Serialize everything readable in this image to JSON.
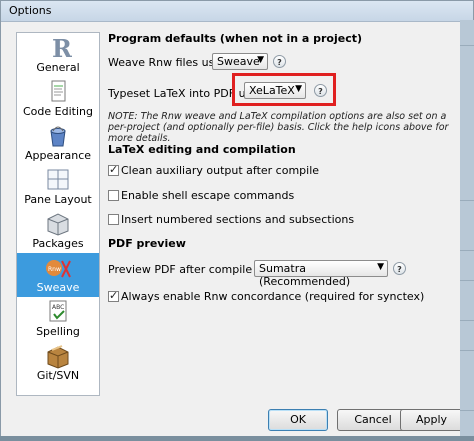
{
  "window": {
    "title": "Options"
  },
  "sidebar": {
    "items": [
      {
        "label": "General",
        "icon": "r-logo-icon"
      },
      {
        "label": "Code Editing",
        "icon": "document-icon"
      },
      {
        "label": "Appearance",
        "icon": "paint-bucket-icon"
      },
      {
        "label": "Pane Layout",
        "icon": "pane-layout-icon"
      },
      {
        "label": "Packages",
        "icon": "package-box-icon"
      },
      {
        "label": "Sweave",
        "icon": "sweave-icon",
        "selected": true
      },
      {
        "label": "Spelling",
        "icon": "spelling-abc-icon"
      },
      {
        "label": "Git/SVN",
        "icon": "git-box-icon"
      }
    ]
  },
  "program_defaults": {
    "heading": "Program defaults (when not in a project)",
    "weave_label": "Weave Rnw files using:",
    "weave_value": "Sweave",
    "typeset_label": "Typeset LaTeX into PDF using:",
    "typeset_value": "XeLaTeX",
    "help_glyph": "?",
    "note": "NOTE: The Rnw weave and LaTeX compilation options are also set on a per-project (and optionally per-file) basis. Click the help icons above for more details."
  },
  "latex": {
    "heading": "LaTeX editing and compilation",
    "options": [
      {
        "label": "Clean auxiliary output after compile",
        "checked": true
      },
      {
        "label": "Enable shell escape commands",
        "checked": false
      },
      {
        "label": "Insert numbered sections and subsections",
        "checked": false
      }
    ]
  },
  "pdf_preview": {
    "heading": "PDF preview",
    "preview_label": "Preview PDF after compile using:",
    "preview_value": "Sumatra (Recommended)",
    "concordance_label": "Always enable Rnw concordance (required for synctex)",
    "concordance_checked": true
  },
  "buttons": {
    "ok": "OK",
    "cancel": "Cancel",
    "apply": "Apply"
  },
  "colors": {
    "selection": "#3c9bde",
    "highlight_box": "#e02020"
  }
}
